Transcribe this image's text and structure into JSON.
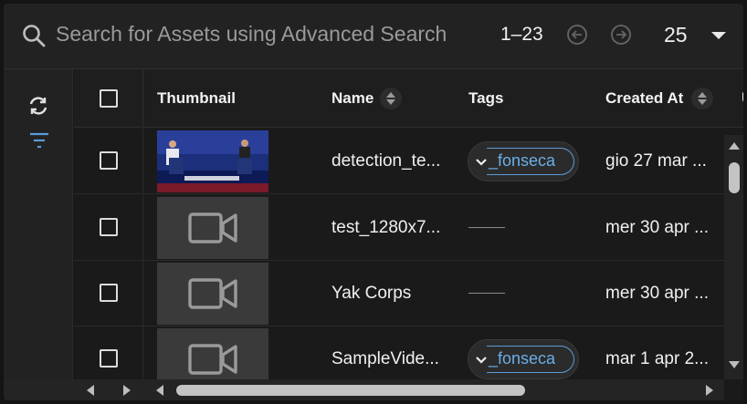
{
  "search": {
    "placeholder": "Search for Assets using Advanced Search"
  },
  "pagination": {
    "range": "1–23",
    "page_size": "25"
  },
  "table": {
    "columns": {
      "thumbnail": "Thumbnail",
      "name": "Name",
      "tags": "Tags",
      "created_at": "Created At",
      "next_partial": "U"
    },
    "rows": [
      {
        "name": "detection_te...",
        "tag": "_fonseca",
        "created_at": "gio 27 mar ..."
      },
      {
        "name": "test_1280x7...",
        "tag": "",
        "created_at": "mer 30 apr ..."
      },
      {
        "name": "Yak Corps",
        "tag": "",
        "created_at": "mer 30 apr ..."
      },
      {
        "name": "SampleVide...",
        "tag": "_fonseca",
        "created_at": "mar 1 apr 2..."
      }
    ]
  },
  "colors": {
    "accent": "#5a9bd8",
    "background": "#1a1a1a",
    "panel": "#222222"
  }
}
